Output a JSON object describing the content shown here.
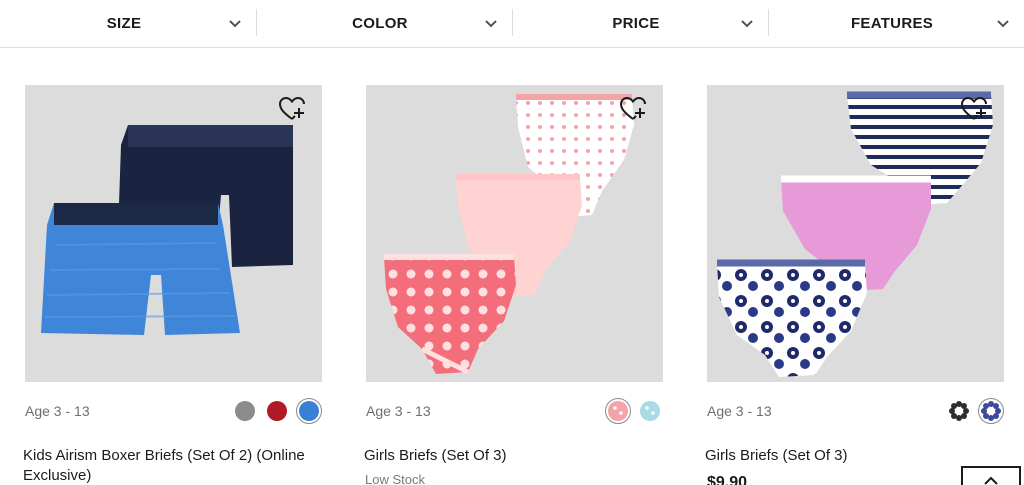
{
  "filters": [
    {
      "label": "SIZE",
      "icon": "chevron-down-icon"
    },
    {
      "label": "COLOR",
      "icon": "chevron-down-icon"
    },
    {
      "label": "PRICE",
      "icon": "chevron-down-icon"
    },
    {
      "label": "FEATURES",
      "icon": "chevron-down-icon"
    }
  ],
  "products": [
    {
      "age": "Age 3 - 13",
      "name": "Kids Airism Boxer Briefs (Set Of 2) (Online Exclusive)",
      "swatches": [
        {
          "color": "#8c8c8c",
          "selected": false
        },
        {
          "color": "#b01a24",
          "selected": false
        },
        {
          "color": "#3a7fd6",
          "selected": true
        }
      ]
    },
    {
      "age": "Age 3 - 13",
      "name": "Girls Briefs (Set Of 3)",
      "stock": "Low Stock",
      "swatches": [
        {
          "color": "#f4a3a9",
          "selected": true,
          "pattern": "polka-dot"
        },
        {
          "color": "#a8dbe6",
          "selected": false,
          "pattern": "polka-dot"
        }
      ]
    },
    {
      "age": "Age 3 - 13",
      "name": "Girls Briefs (Set Of 3)",
      "price": "$9.90",
      "swatches": [
        {
          "color": "#3a3a3a",
          "selected": false,
          "pattern": "floral"
        },
        {
          "color": "#3b4a9a",
          "selected": true,
          "pattern": "floral"
        }
      ]
    }
  ],
  "icons": {
    "wishlist": "heart-plus-icon",
    "back_to_top": "back-to-top-button"
  },
  "colors": {
    "text": "#1b1b1b",
    "muted": "#6e6e6e",
    "image_bg": "#dcdcdc",
    "divider": "#dcdcdc"
  }
}
